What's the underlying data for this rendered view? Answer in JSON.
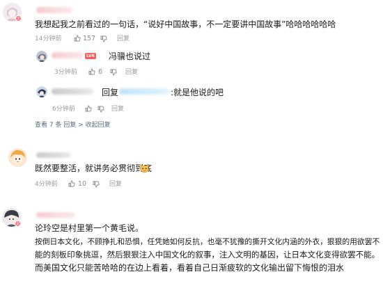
{
  "comments": [
    {
      "text": "我想起我之前看过的一句话，“说好中国故事，不一定要讲中国故事”哈哈哈哈哈哈",
      "time": "14分钟前",
      "likes": "157"
    },
    {
      "text": "既然要整活，就讲务必贯彻到底",
      "time": "4分钟前",
      "likes": "10"
    },
    {
      "lines": [
        "论玲空是村里第一个黄毛说。",
        "按倒日本文化，不顾挣扎和恐惧，任凭她如何反抗，也毫不犹豫的撕开文化内涵的外衣，狠狠的用欲罢不",
        "能的刻板印象挑逗，然后狠狠注入中国文化的叙事，注入文明的基因，让日本文化变得欲罢不能。",
        "而美国文化只能苦哈哈的在边上看着，看着自己日渐疲软的文化输出留下悔恨的泪水"
      ]
    }
  ],
  "replies": [
    {
      "level_tag": "LV6",
      "text": "冯骥也说过",
      "time": "3分钟前",
      "likes": "6"
    },
    {
      "reply_prefix": "回复",
      "text_suffix": ":就是他说的吧",
      "time": "6分钟前"
    }
  ],
  "reply_summary": {
    "view_replies": "查看 7 条",
    "collapse": "回复",
    "label": "查看 7 条  回复  >  收起回复"
  },
  "reply_buttons": [
    "回复",
    "回复",
    "回复",
    "回复"
  ],
  "colors": {
    "badge": "#ff6a70",
    "level_tag": "#ff5a5a",
    "meta_gray": "#9a9a9a",
    "mention_blue": "#3c6aa8"
  }
}
